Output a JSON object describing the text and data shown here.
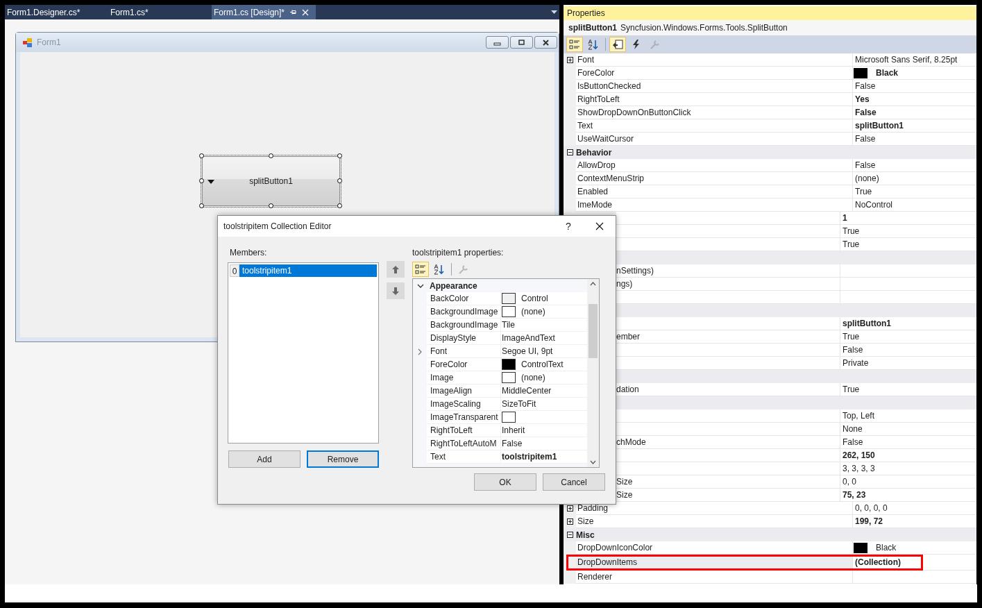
{
  "tabs": [
    {
      "label": "Form1.Designer.cs*",
      "selected": false
    },
    {
      "label": "Form1.cs*",
      "selected": false
    },
    {
      "label": "Form1.cs [Design]*",
      "selected": true
    }
  ],
  "form": {
    "title": "Form1",
    "control": {
      "text": "splitButton1",
      "selected": true
    }
  },
  "properties": {
    "title": "Properties",
    "object_name": "splitButton1",
    "object_type": "Syncfusion.Windows.Forms.Tools.SplitButton",
    "toolbar": [
      {
        "kind": "categorized",
        "selected": true,
        "disabled": false
      },
      {
        "kind": "alphabetical",
        "selected": false,
        "disabled": false
      },
      {
        "kind": "properties",
        "selected": true,
        "disabled": false
      },
      {
        "kind": "events",
        "selected": false,
        "disabled": false
      },
      {
        "kind": "pages",
        "selected": false,
        "disabled": true
      }
    ],
    "rows": [
      {
        "kind": "prop",
        "name": "Font",
        "value": "Microsoft Sans Serif, 8.25pt",
        "bold": false,
        "expandable": true,
        "highlighted": false
      },
      {
        "kind": "prop",
        "name": "ForeColor",
        "value": "Black",
        "bold": true,
        "color": "#000000",
        "expandable": false,
        "highlighted": false
      },
      {
        "kind": "prop",
        "name": "IsButtonChecked",
        "value": "False",
        "bold": false,
        "expandable": false,
        "highlighted": false
      },
      {
        "kind": "prop",
        "name": "RightToLeft",
        "value": "Yes",
        "bold": true,
        "expandable": false,
        "highlighted": false
      },
      {
        "kind": "prop",
        "name": "ShowDropDownOnButtonClick",
        "value": "False",
        "bold": true,
        "expandable": false,
        "highlighted": false
      },
      {
        "kind": "prop",
        "name": "Text",
        "value": "splitButton1",
        "bold": true,
        "expandable": false,
        "highlighted": false
      },
      {
        "kind": "prop",
        "name": "UseWaitCursor",
        "value": "False",
        "bold": false,
        "expandable": false,
        "highlighted": false
      },
      {
        "kind": "group",
        "name": "Behavior",
        "expanded": true
      },
      {
        "kind": "prop",
        "name": "AllowDrop",
        "value": "False",
        "bold": false,
        "expandable": false,
        "highlighted": false
      },
      {
        "kind": "prop",
        "name": "ContextMenuStrip",
        "value": "(none)",
        "bold": false,
        "expandable": false,
        "highlighted": false
      },
      {
        "kind": "prop",
        "name": "Enabled",
        "value": "True",
        "bold": false,
        "expandable": false,
        "highlighted": false
      },
      {
        "kind": "prop",
        "name": "ImeMode",
        "value": "NoControl",
        "bold": false,
        "expandable": false,
        "highlighted": false
      },
      {
        "kind": "prop",
        "value": "1",
        "bold": true,
        "highlighted": false
      },
      {
        "kind": "prop",
        "value": "True",
        "bold": false,
        "highlighted": false
      },
      {
        "kind": "prop",
        "value": "True",
        "bold": false,
        "highlighted": false
      },
      {
        "kind": "group",
        "expanded": true
      },
      {
        "kind": "prop",
        "name": "nSettings)",
        "highlighted": false
      },
      {
        "kind": "prop",
        "name": "ngs)",
        "highlighted": false
      },
      {
        "kind": "prop",
        "highlighted": false
      },
      {
        "kind": "group",
        "expanded": true
      },
      {
        "kind": "prop",
        "value": "splitButton1",
        "bold": true,
        "highlighted": false
      },
      {
        "kind": "prop",
        "name": "ember",
        "value": "True",
        "bold": false,
        "highlighted": false
      },
      {
        "kind": "prop",
        "value": "False",
        "bold": false,
        "highlighted": false
      },
      {
        "kind": "prop",
        "value": "Private",
        "bold": false,
        "highlighted": false
      },
      {
        "kind": "group",
        "expanded": true
      },
      {
        "kind": "prop",
        "name": "dation",
        "value": "True",
        "bold": false,
        "highlighted": false
      },
      {
        "kind": "group",
        "expanded": true
      },
      {
        "kind": "prop",
        "value": "Top, Left",
        "bold": false,
        "highlighted": false
      },
      {
        "kind": "prop",
        "value": "None",
        "bold": false,
        "highlighted": false
      },
      {
        "kind": "prop",
        "name": "chMode",
        "value": "False",
        "bold": false,
        "highlighted": false
      },
      {
        "kind": "prop",
        "value": "262, 150",
        "bold": true,
        "highlighted": false
      },
      {
        "kind": "prop",
        "value": "3, 3, 3, 3",
        "bold": false,
        "highlighted": false
      },
      {
        "kind": "prop",
        "name": "Size",
        "value": "0, 0",
        "bold": false,
        "highlighted": false
      },
      {
        "kind": "prop",
        "name": "Size",
        "value": "75, 23",
        "bold": true,
        "highlighted": false
      },
      {
        "kind": "prop",
        "name": "Padding",
        "value": "0, 0, 0, 0",
        "bold": false,
        "expandable": true,
        "highlighted": false
      },
      {
        "kind": "prop",
        "name": "Size",
        "value": "199, 72",
        "bold": true,
        "expandable": true,
        "highlighted": false
      },
      {
        "kind": "group",
        "name": "Misc",
        "expanded": true
      },
      {
        "kind": "prop",
        "name": "DropDownIconColor",
        "value": "Black",
        "bold": false,
        "color": "#000000",
        "expandable": false,
        "highlighted": false
      },
      {
        "kind": "prop",
        "name": "DropDownItems",
        "value": "(Collection)",
        "bold": true,
        "expandable": false,
        "highlighted": true
      },
      {
        "kind": "prop",
        "name": "Renderer",
        "expandable": false,
        "highlighted": false
      }
    ]
  },
  "dialog": {
    "title": "toolstripitem Collection Editor",
    "help": "?",
    "members_label": "Members:",
    "members": [
      {
        "index": "0",
        "label": "toolstripitem1",
        "selected": true
      }
    ],
    "add": "Add",
    "remove": "Remove",
    "grid_label": "toolstripitem1 properties:",
    "toolbar": [
      {
        "kind": "categorized",
        "selected": true,
        "disabled": false
      },
      {
        "kind": "alphabetical",
        "selected": false,
        "disabled": false
      },
      {
        "kind": "pages",
        "selected": false,
        "disabled": true
      }
    ],
    "rows": [
      {
        "kind": "group",
        "name": "Appearance",
        "expanded": true
      },
      {
        "kind": "prop",
        "name": "BackColor",
        "value": "Control",
        "color": "#f0f0f0",
        "bold": false,
        "expandable": false
      },
      {
        "kind": "prop",
        "name": "BackgroundImage",
        "value": "(none)",
        "color": "#ffffff",
        "bold": false,
        "expandable": false
      },
      {
        "kind": "prop",
        "name": "BackgroundImage",
        "value": "Tile",
        "bold": false,
        "expandable": false
      },
      {
        "kind": "prop",
        "name": "DisplayStyle",
        "value": "ImageAndText",
        "bold": false,
        "expandable": false
      },
      {
        "kind": "prop",
        "name": "Font",
        "value": "Segoe UI, 9pt",
        "bold": false,
        "expandable": true
      },
      {
        "kind": "prop",
        "name": "ForeColor",
        "value": "ControlText",
        "color": "#000000",
        "bold": false,
        "expandable": false
      },
      {
        "kind": "prop",
        "name": "Image",
        "value": "(none)",
        "color": "#ffffff",
        "bold": false,
        "expandable": false
      },
      {
        "kind": "prop",
        "name": "ImageAlign",
        "value": "MiddleCenter",
        "bold": false,
        "expandable": false
      },
      {
        "kind": "prop",
        "name": "ImageScaling",
        "value": "SizeToFit",
        "bold": false,
        "expandable": false
      },
      {
        "kind": "prop",
        "name": "ImageTransparent",
        "color": "#ffffff",
        "expandable": false
      },
      {
        "kind": "prop",
        "name": "RightToLeft",
        "value": "Inherit",
        "bold": false,
        "expandable": false
      },
      {
        "kind": "prop",
        "name": "RightToLeftAutoM",
        "value": "False",
        "bold": false,
        "expandable": false
      },
      {
        "kind": "prop",
        "name": "Text",
        "value": "toolstripitem1",
        "bold": true,
        "expandable": false
      }
    ],
    "ok": "OK",
    "cancel": "Cancel"
  }
}
